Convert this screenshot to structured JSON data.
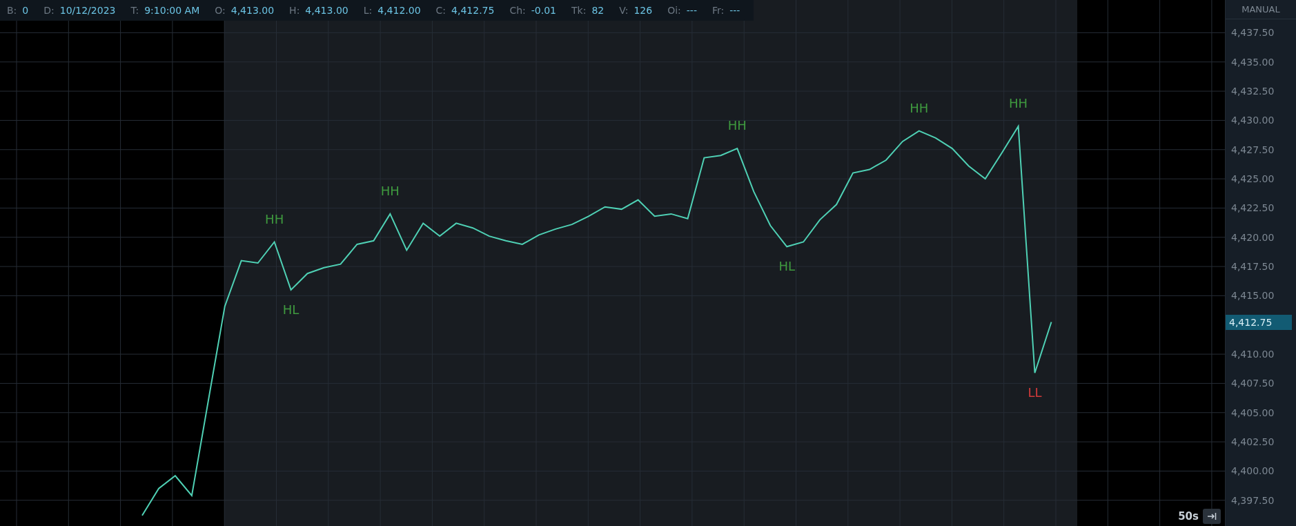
{
  "info_bar": [
    {
      "label": "B:",
      "value": "0"
    },
    {
      "label": "D:",
      "value": "10/12/2023"
    },
    {
      "label": "T:",
      "value": "9:10:00 AM"
    },
    {
      "label": "O:",
      "value": "4,413.00"
    },
    {
      "label": "H:",
      "value": "4,413.00"
    },
    {
      "label": "L:",
      "value": "4,412.00"
    },
    {
      "label": "C:",
      "value": "4,412.75"
    },
    {
      "label": "Ch:",
      "value": "-0.01"
    },
    {
      "label": "Tk:",
      "value": "82"
    },
    {
      "label": "V:",
      "value": "126"
    },
    {
      "label": "Oi:",
      "value": "---"
    },
    {
      "label": "Fr:",
      "value": "---"
    }
  ],
  "price_axis": {
    "mode": "MANUAL",
    "last_price": "4,412.75"
  },
  "chart_data": {
    "type": "line",
    "grid": true,
    "ylim": [
      4395.3,
      4440.3
    ],
    "yticks": [
      {
        "value": 4437.5,
        "label": "4,437.50"
      },
      {
        "value": 4435,
        "label": "4,435.00"
      },
      {
        "value": 4432.5,
        "label": "4,432.50"
      },
      {
        "value": 4430,
        "label": "4,430.00"
      },
      {
        "value": 4427.5,
        "label": "4,427.50"
      },
      {
        "value": 4425,
        "label": "4,425.00"
      },
      {
        "value": 4422.5,
        "label": "4,422.50"
      },
      {
        "value": 4420,
        "label": "4,420.00"
      },
      {
        "value": 4417.5,
        "label": "4,417.50"
      },
      {
        "value": 4415,
        "label": "4,415.00"
      },
      {
        "value": 4410,
        "label": "4,410.00"
      },
      {
        "value": 4407.5,
        "label": "4,407.50"
      },
      {
        "value": 4405,
        "label": "4,405.00"
      },
      {
        "value": 4402.5,
        "label": "4,402.50"
      },
      {
        "value": 4400,
        "label": "4,400.00"
      },
      {
        "value": 4397.5,
        "label": "4,397.50"
      }
    ],
    "series": [
      {
        "color": "#4fd1b5",
        "values": [
          4396.2,
          4398.5,
          4399.6,
          4397.9,
          4406,
          4414.1,
          4418,
          4417.8,
          4419.6,
          4415.5,
          4416.9,
          4417.4,
          4417.7,
          4419.4,
          4419.7,
          4422,
          4418.9,
          4421.2,
          4420.1,
          4421.2,
          4420.8,
          4420.1,
          4419.7,
          4419.4,
          4420.2,
          4420.7,
          4421.1,
          4421.8,
          4422.6,
          4422.4,
          4423.2,
          4421.8,
          4422,
          4421.6,
          4426.8,
          4427,
          4427.6,
          4423.9,
          4421,
          4419.2,
          4419.6,
          4421.5,
          4422.8,
          4425.5,
          4425.8,
          4426.6,
          4428.2,
          4429.1,
          4428.5,
          4427.6,
          4426.1,
          4425,
          4427.2,
          4429.5,
          4408.4,
          4412.75
        ]
      }
    ],
    "annotations": [
      {
        "y": 4419.6,
        "text": "HH"
      },
      {
        "y": 4415.5,
        "text": "HL"
      },
      {
        "y": 4422,
        "text": "HH"
      },
      {
        "y": 4427.6,
        "text": "HH"
      },
      {
        "y": 4419.2,
        "text": "HL"
      },
      {
        "y": 4429.1,
        "text": "HH"
      },
      {
        "y": 4429.5,
        "text": "HH"
      },
      {
        "y": 4408.4,
        "text": "LL"
      }
    ]
  },
  "timeframe": {
    "label": "50s"
  }
}
